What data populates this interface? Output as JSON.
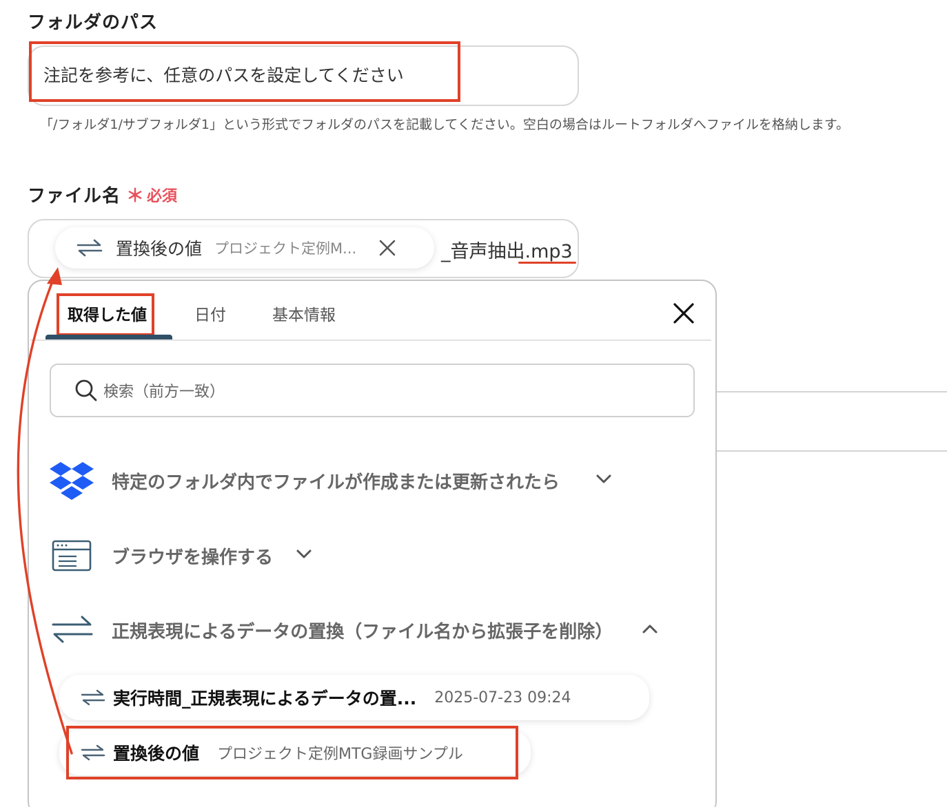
{
  "folder": {
    "label": "フォルダのパス",
    "input_value": "注記を参考に、任意のパスを設定してください",
    "hint": "「/フォルダ1/サブフォルダ1」という形式でフォルダのパスを記載してください。空白の場合はルートフォルダへファイルを格納します。"
  },
  "filename": {
    "label": "ファイル名",
    "required_mark": "＊",
    "required_text": "必須",
    "chip_label": "置換後の値",
    "chip_value": "プロジェクト定例M...",
    "suffix": "_音声抽出.mp3"
  },
  "panel": {
    "tabs": [
      "取得した値",
      "日付",
      "基本情報"
    ],
    "search_placeholder": "検索（前方一致）",
    "groups": [
      {
        "title": "特定のフォルダ内でファイルが作成または更新されたら",
        "icon": "dropbox-icon"
      },
      {
        "title": "ブラウザを操作する",
        "icon": "browser-icon"
      },
      {
        "title": "正規表現によるデータの置換（ファイル名から拡張子を削除）",
        "icon": "swap-icon"
      }
    ],
    "items": [
      {
        "label": "実行時間_正規表現によるデータの置...",
        "value": "2025-07-23 09:24"
      },
      {
        "label": "置換後の値",
        "value": "プロジェクト定例MTG録画サンプル"
      }
    ]
  },
  "colors": {
    "accent_red": "#e04128",
    "required_red": "#e8505b",
    "tab_underline": "#2f4f66",
    "dropbox_blue": "#1f5cf5"
  }
}
